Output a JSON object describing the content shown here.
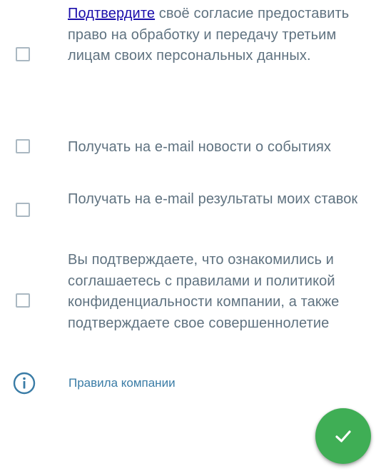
{
  "consents": [
    {
      "link_text": "Подтвердите",
      "text": " своё согласие предоставить право на обработку и передачу третьим лицам своих персональных данных."
    },
    {
      "text": "Получать на e-mail новости о событиях"
    },
    {
      "text": "Получать на e-mail результаты моих ставок"
    },
    {
      "text": "Вы подтверждаете, что ознакомились и соглашаетесь с правилами и политикой конфиденциальности компании, а также подтверждаете свое совершеннолетие"
    }
  ],
  "rules": {
    "icon": "info-icon",
    "label": "Правила компании"
  },
  "fab": {
    "icon": "check-icon",
    "color": "#3fae55"
  },
  "colors": {
    "text": "#5f7280",
    "link": "#1a0dab",
    "rules_link": "#3a7ca6",
    "checkbox_border": "#aab8c2"
  }
}
